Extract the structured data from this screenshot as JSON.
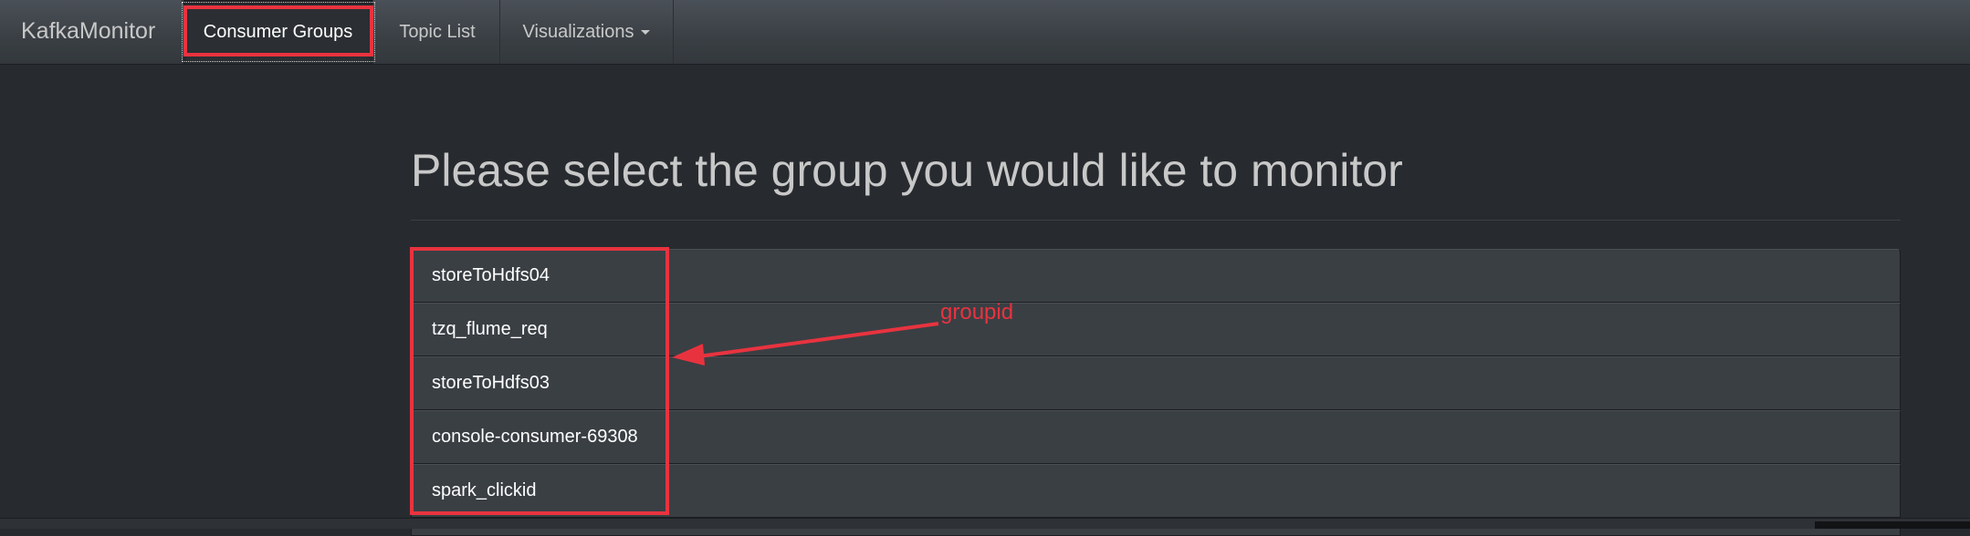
{
  "navbar": {
    "brand": "KafkaMonitor",
    "items": [
      {
        "label": "Consumer Groups",
        "active": true
      },
      {
        "label": "Topic List",
        "active": false
      },
      {
        "label": "Visualizations",
        "dropdown": true,
        "active": false
      }
    ]
  },
  "main": {
    "title": "Please select the group you would like to monitor",
    "groups": [
      "storeToHdfs04",
      "tzq_flume_req",
      "storeToHdfs03",
      "console-consumer-69308",
      "spark_clickid"
    ]
  },
  "annotation": {
    "label": "groupid",
    "color": "#e8333f"
  },
  "colors": {
    "background": "#272b30",
    "navbar": "#3a3f44",
    "list_item": "#3a3f44",
    "text": "#c8c8c8",
    "annotation": "#e8333f"
  }
}
